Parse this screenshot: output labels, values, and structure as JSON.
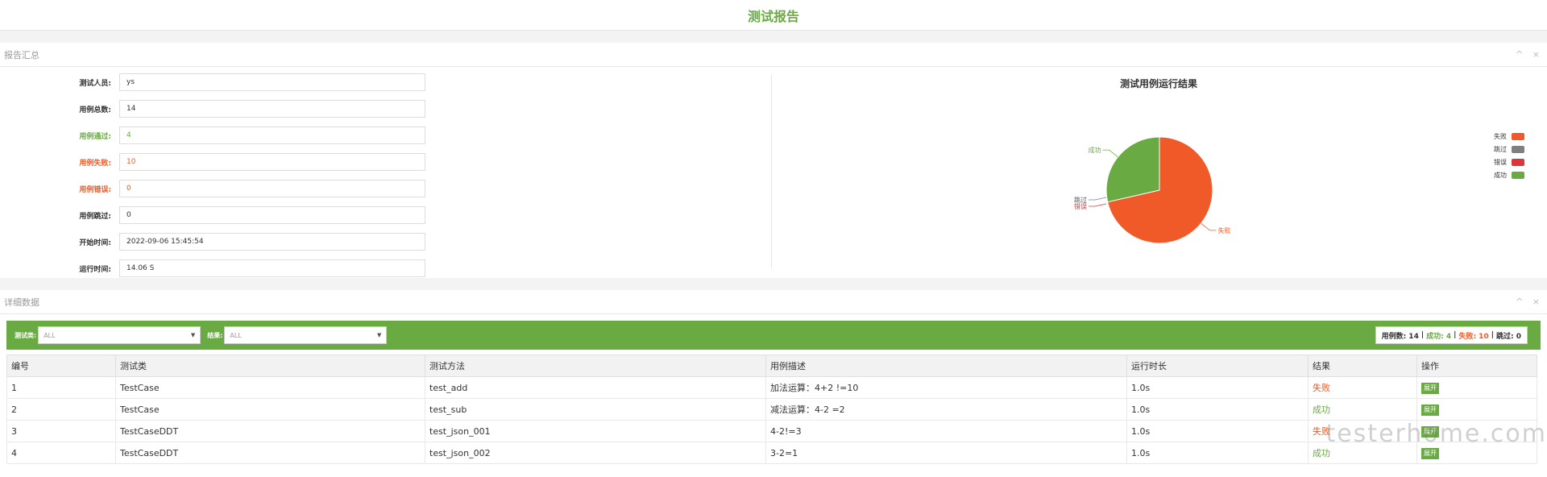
{
  "page_title": "测试报告",
  "summary_panel": {
    "title": "报告汇总",
    "controls": "^ ×"
  },
  "summary": {
    "rows": [
      {
        "label": "测试人员:",
        "value": "ys",
        "style": "normal"
      },
      {
        "label": "用例总数:",
        "value": "14",
        "style": "normal"
      },
      {
        "label": "用例通过:",
        "value": "4",
        "style": "green"
      },
      {
        "label": "用例失败:",
        "value": "10",
        "style": "red"
      },
      {
        "label": "用例错误:",
        "value": "0",
        "style": "red"
      },
      {
        "label": "用例跳过:",
        "value": "0",
        "style": "normal"
      },
      {
        "label": "开始时间:",
        "value": "2022-09-06 15:45:54",
        "style": "normal"
      },
      {
        "label": "运行时间:",
        "value": "14.06 S",
        "style": "normal"
      }
    ]
  },
  "chart_data": {
    "type": "pie",
    "title": "测试用例运行结果",
    "slices": [
      {
        "name": "失败",
        "value": 10,
        "color": "#f05a28"
      },
      {
        "name": "跳过",
        "value": 0,
        "color": "#7f7f7f"
      },
      {
        "name": "错误",
        "value": 0,
        "color": "#d9363e"
      },
      {
        "name": "成功",
        "value": 4,
        "color": "#6aaa43"
      }
    ],
    "legend": [
      "失败",
      "跳过",
      "错误",
      "成功"
    ],
    "legend_position": "right"
  },
  "detail_panel": {
    "title": "详细数据",
    "controls": "^ ×"
  },
  "filters": {
    "class_label": "测试类:",
    "class_value": "ALL",
    "result_label": "结果:",
    "result_value": "ALL"
  },
  "counts": {
    "total_label": "用例数: 14",
    "pass_label": "成功: 4",
    "fail_label": "失败: 10",
    "skip_label": "跳过: 0",
    "sep": "|"
  },
  "table": {
    "headers": [
      "编号",
      "测试类",
      "测试方法",
      "用例描述",
      "运行时长",
      "结果",
      "操作"
    ],
    "rows": [
      {
        "id": "1",
        "cls": "TestCase",
        "method": "test_add",
        "desc": "加法运算：4+2 !=10",
        "time": "1.0s",
        "result": "失败",
        "status": "fail",
        "action": "展开"
      },
      {
        "id": "2",
        "cls": "TestCase",
        "method": "test_sub",
        "desc": "减法运算：4-2 =2",
        "time": "1.0s",
        "result": "成功",
        "status": "pass",
        "action": "展开"
      },
      {
        "id": "3",
        "cls": "TestCaseDDT",
        "method": "test_json_001",
        "desc": "4-2!=3",
        "time": "1.0s",
        "result": "失败",
        "status": "fail",
        "action": "展开"
      },
      {
        "id": "4",
        "cls": "TestCaseDDT",
        "method": "test_json_002",
        "desc": "3-2=1",
        "time": "1.0s",
        "result": "成功",
        "status": "pass",
        "action": "展开"
      }
    ]
  },
  "watermark": "testerhome.com"
}
